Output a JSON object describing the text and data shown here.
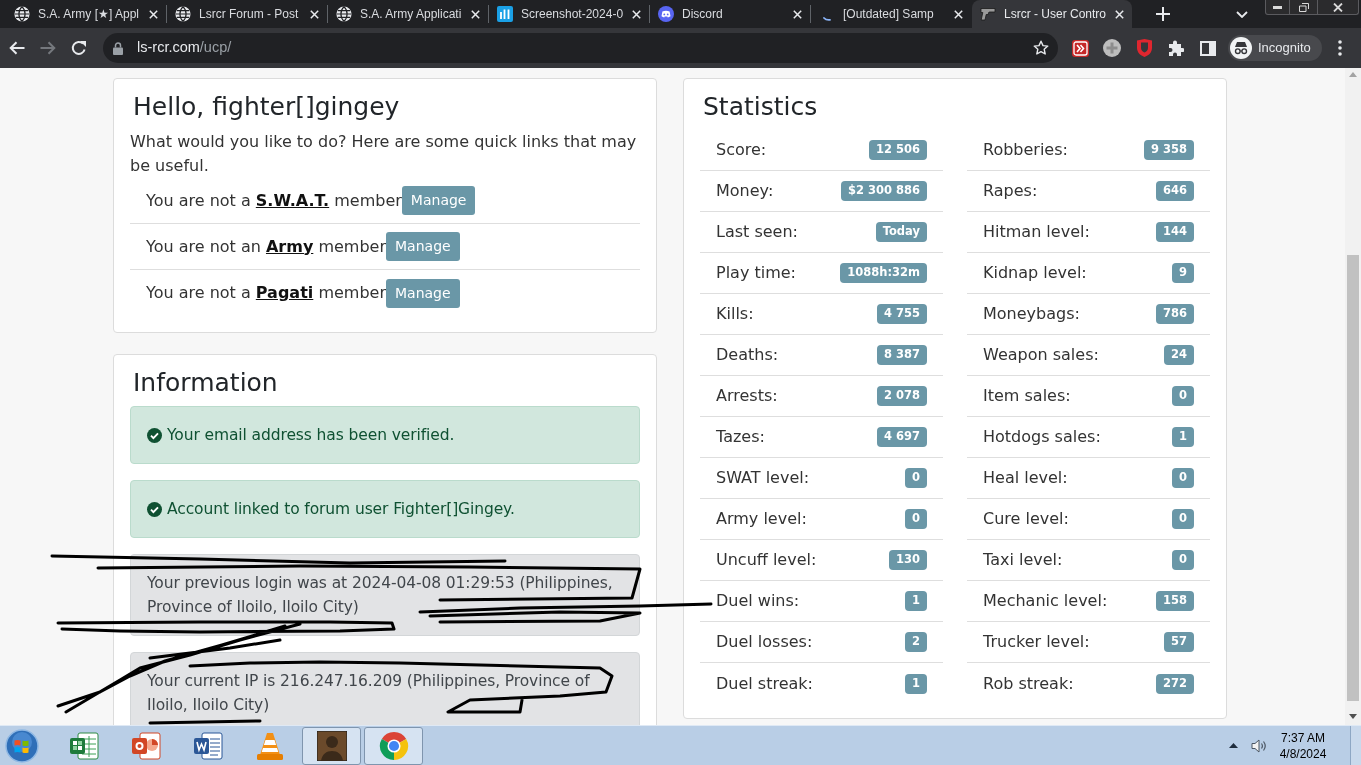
{
  "browser": {
    "tabs": [
      {
        "kind": "globe",
        "title": "S.A. Army [★] Appl",
        "selected": false
      },
      {
        "kind": "globe",
        "title": "Lsrcr Forum - Post",
        "selected": false
      },
      {
        "kind": "globe",
        "title": "S.A. Army Applicati",
        "selected": false
      },
      {
        "kind": "tile",
        "title": "Screenshot-2024-0",
        "selected": false
      },
      {
        "kind": "round",
        "title": "Discord",
        "selected": false
      },
      {
        "kind": "loading",
        "title": "[Outdated] Samp",
        "selected": false
      },
      {
        "kind": "pistol",
        "title": "Lsrcr - User Contro",
        "selected": true
      }
    ],
    "forward_disabled": true,
    "url": {
      "host": "ls-rcr.com",
      "path": "/ucp/"
    },
    "profile_label": "Incognito"
  },
  "welcome": {
    "title": "Hello, fighter[]gingey",
    "intro": "What would you like to do? Here are some quick links that may be useful.",
    "memberships": [
      {
        "prefix": "You are not a",
        "group": "S.W.A.T.",
        "suffix": "member",
        "button": "Manage"
      },
      {
        "prefix": "You are not an",
        "group": "Army",
        "suffix": "member",
        "button": "Manage"
      },
      {
        "prefix": "You are not a",
        "group": "Pagati",
        "suffix": "member",
        "button": "Manage"
      }
    ]
  },
  "information": {
    "title": "Information",
    "alerts": [
      {
        "kind": "success",
        "text": "Your email address has been verified."
      },
      {
        "kind": "success",
        "text": "Account linked to forum user Fighter[]Gingey."
      },
      {
        "kind": "secondary",
        "text": "Your previous login was at 2024-04-08 01:29:53 (Philippines, Province of Iloilo, Iloilo City)"
      },
      {
        "kind": "secondary",
        "text": "Your current IP is 216.247.16.209 (Philippines, Province of Iloilo, Iloilo City)"
      }
    ]
  },
  "statistics": {
    "title": "Statistics",
    "columns": [
      {
        "rows": [
          {
            "label": "Score:",
            "value": "12 506"
          },
          {
            "label": "Money:",
            "value": "$2 300 886"
          },
          {
            "label": "Last seen:",
            "value": "Today"
          },
          {
            "label": "Play time:",
            "value": "1088h:32m"
          },
          {
            "label": "Kills:",
            "value": "4 755"
          },
          {
            "label": "Deaths:",
            "value": "8 387"
          },
          {
            "label": "Arrests:",
            "value": "2 078"
          },
          {
            "label": "Tazes:",
            "value": "4 697"
          },
          {
            "label": "SWAT level:",
            "value": "0"
          },
          {
            "label": "Army level:",
            "value": "0"
          },
          {
            "label": "Uncuff level:",
            "value": "130"
          },
          {
            "label": "Duel wins:",
            "value": "1"
          },
          {
            "label": "Duel losses:",
            "value": "2"
          },
          {
            "label": "Duel streak:",
            "value": "1"
          }
        ]
      },
      {
        "rows": [
          {
            "label": "Robberies:",
            "value": "9 358"
          },
          {
            "label": "Rapes:",
            "value": "646"
          },
          {
            "label": "Hitman level:",
            "value": "144"
          },
          {
            "label": "Kidnap level:",
            "value": "9"
          },
          {
            "label": "Moneybags:",
            "value": "786"
          },
          {
            "label": "Weapon sales:",
            "value": "24"
          },
          {
            "label": "Item sales:",
            "value": "0"
          },
          {
            "label": "Hotdogs sales:",
            "value": "1"
          },
          {
            "label": "Heal level:",
            "value": "0"
          },
          {
            "label": "Cure level:",
            "value": "0"
          },
          {
            "label": "Taxi level:",
            "value": "0"
          },
          {
            "label": "Mechanic level:",
            "value": "158"
          },
          {
            "label": "Trucker level:",
            "value": "57"
          },
          {
            "label": "Rob streak:",
            "value": "272"
          }
        ]
      }
    ]
  },
  "taskbar": {
    "apps": [
      {
        "kind": "spreadsheet",
        "running": false
      },
      {
        "kind": "presentation",
        "running": false
      },
      {
        "kind": "document",
        "running": false
      },
      {
        "kind": "cone",
        "running": false
      },
      {
        "kind": "game",
        "running": true
      },
      {
        "kind": "browser",
        "running": true
      }
    ],
    "clock": {
      "time": "7:37 AM",
      "date": "4/8/2024"
    }
  }
}
